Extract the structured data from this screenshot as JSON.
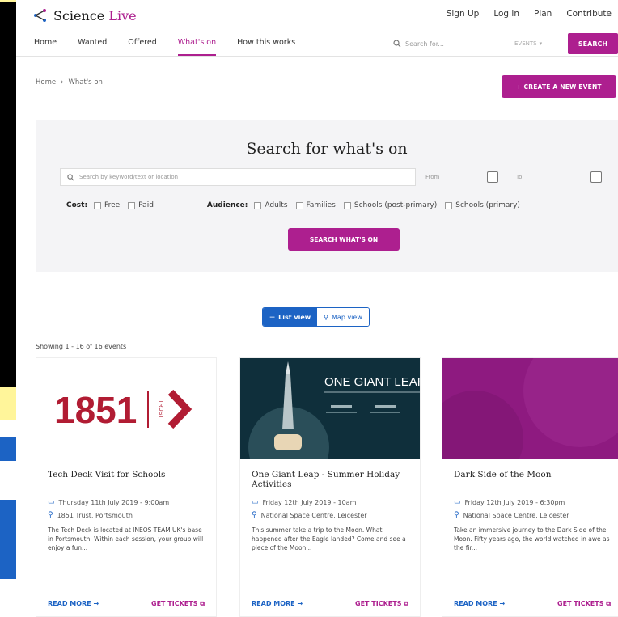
{
  "brand": {
    "name_prefix": "Science",
    "name_suffix": "Live"
  },
  "top_links": [
    "Sign Up",
    "Log in",
    "Plan",
    "Contribute"
  ],
  "nav": {
    "items": [
      "Home",
      "Wanted",
      "Offered",
      "What's on",
      "How this works"
    ],
    "active_index": 3,
    "search_placeholder": "Search for...",
    "search_scope": "EVENTS",
    "search_button": "SEARCH"
  },
  "breadcrumb": {
    "home": "Home",
    "separator": "›",
    "current": "What's on"
  },
  "create_button": "+ CREATE A NEW EVENT",
  "search_panel": {
    "title": "Search for what's on",
    "keyword_placeholder": "Search by keyword/text or location",
    "from_placeholder": "From",
    "to_placeholder": "To",
    "cost_label": "Cost:",
    "cost_options": [
      "Free",
      "Paid"
    ],
    "audience_label": "Audience:",
    "audience_options": [
      "Adults",
      "Families",
      "Schools (post-primary)",
      "Schools (primary)"
    ],
    "submit": "SEARCH WHAT'S ON"
  },
  "view_toggle": {
    "list": "List view",
    "map": "Map view",
    "active": "list"
  },
  "showing": "Showing 1 - 16 of 16 events",
  "events": [
    {
      "title": "Tech Deck Visit for Schools",
      "date": "Thursday 11th July 2019 - 9:00am",
      "location": "1851 Trust, Portsmouth",
      "description": "The Tech Deck is located at INEOS TEAM UK's base in Portsmouth. Within each session, your group will enjoy a fun...",
      "read_more": "READ MORE",
      "tickets": "GET TICKETS",
      "logo_number": "1851",
      "logo_word": "TRUST"
    },
    {
      "title": "One Giant Leap - Summer Holiday Activities",
      "date": "Friday 12th July 2019 - 10am",
      "location": "National Space Centre, Leicester",
      "description": "This summer take a trip to the Moon. What happened after the Eagle landed? Come and see a piece of the Moon...",
      "read_more": "READ MORE",
      "tickets": "GET TICKETS",
      "image_caption": "ONE GIANT LEAP"
    },
    {
      "title": "Dark Side of the Moon",
      "date": "Friday 12th July 2019 - 6:30pm",
      "location": "National Space Centre, Leicester",
      "description": "Take an immersive journey to the Dark Side of the Moon. Fifty years ago, the world watched in awe as the fir...",
      "read_more": "READ MORE",
      "tickets": "GET TICKETS"
    }
  ],
  "colors": {
    "brand": "#ad1f8f",
    "link": "#1c63c4",
    "panel": "#f4f4f6"
  }
}
